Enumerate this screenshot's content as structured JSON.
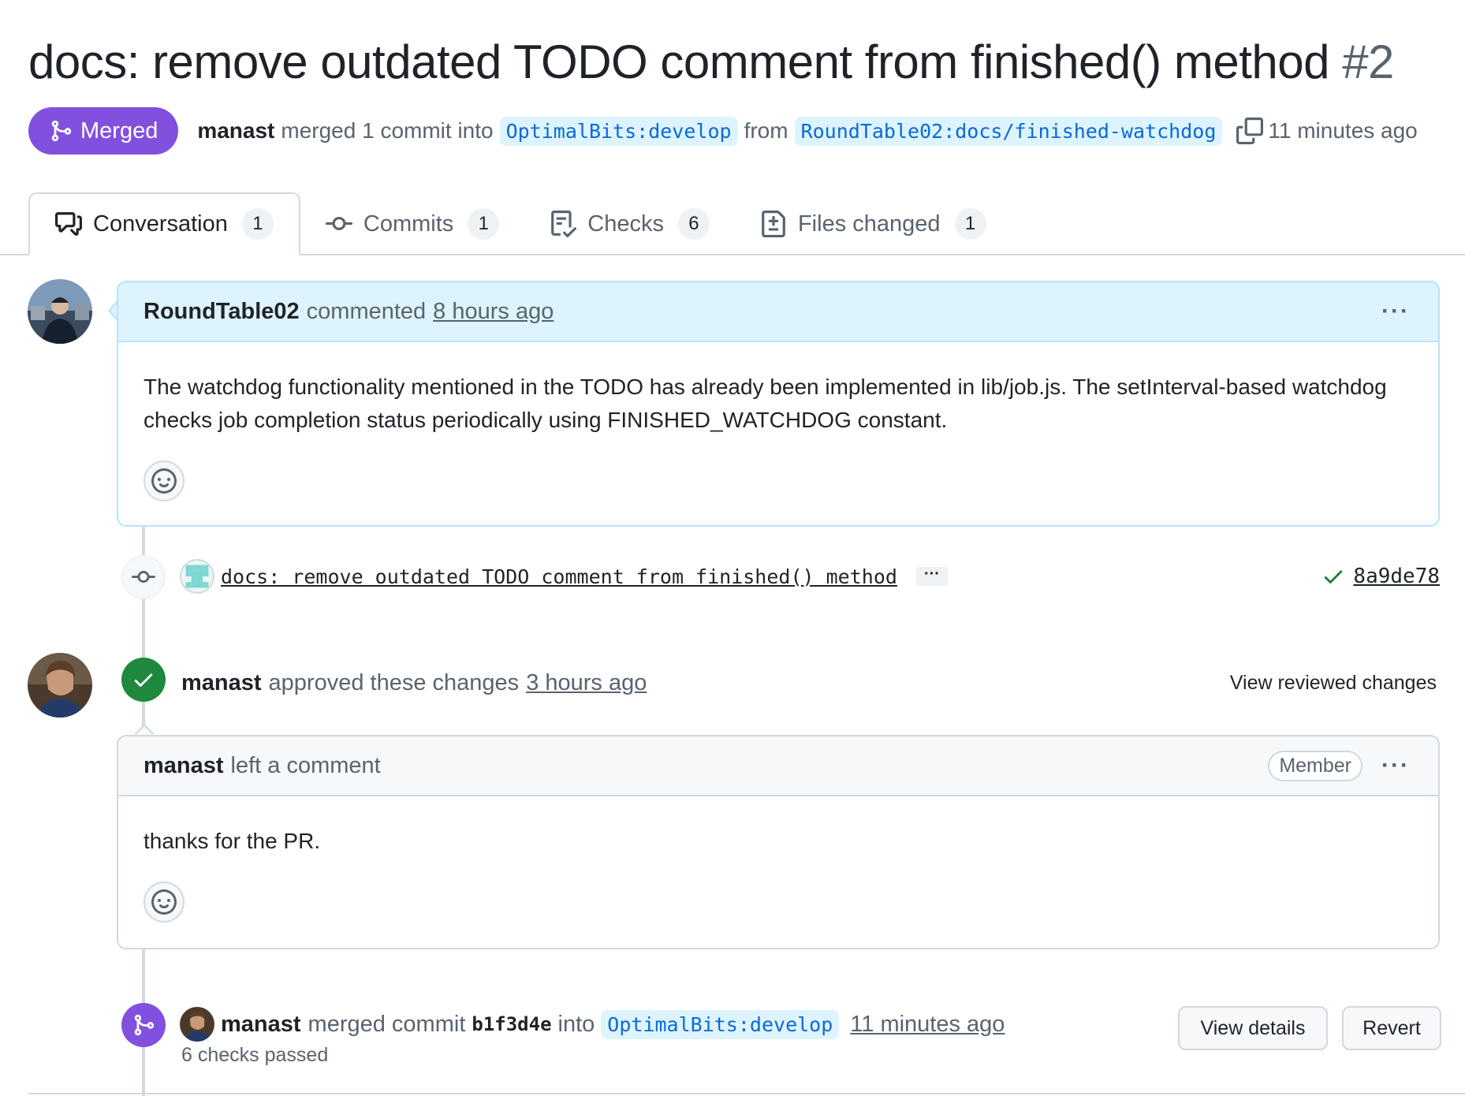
{
  "pr": {
    "title": "docs: remove outdated TODO comment from finished() method",
    "number": "#2",
    "state": "Merged",
    "meta_author": "manast",
    "meta_text": "merged 1 commit into",
    "base_branch": "OptimalBits:develop",
    "from_text": "from",
    "head_branch": "RoundTable02:docs/finished-watchdog",
    "meta_time": "11 minutes ago"
  },
  "tabs": [
    {
      "label": "Conversation",
      "count": "1",
      "icon": "comment-discussion-icon"
    },
    {
      "label": "Commits",
      "count": "1",
      "icon": "git-commit-icon"
    },
    {
      "label": "Checks",
      "count": "6",
      "icon": "checklist-icon"
    },
    {
      "label": "Files changed",
      "count": "1",
      "icon": "file-diff-icon"
    }
  ],
  "comment1": {
    "author": "RoundTable02",
    "action": "commented",
    "time": "8 hours ago",
    "body": "The watchdog functionality mentioned in the TODO has already been implemented in lib/job.js. The setInterval-based watchdog checks job completion status periodically using FINISHED_WATCHDOG constant.",
    "more": "···"
  },
  "commit": {
    "message": "docs: remove outdated TODO comment from finished() method",
    "ellipsis": "···",
    "sha": "8a9de78"
  },
  "review": {
    "author": "manast",
    "action": "approved these changes",
    "time": "3 hours ago",
    "view_link": "View reviewed changes"
  },
  "comment2": {
    "author": "manast",
    "action": "left a comment",
    "badge": "Member",
    "body": "thanks for the PR.",
    "more": "···"
  },
  "merge": {
    "author": "manast",
    "action": "merged commit",
    "sha": "b1f3d4e",
    "into": "into",
    "branch": "OptimalBits:develop",
    "time": "11 minutes ago",
    "checks": "6 checks passed",
    "view_details": "View details",
    "revert": "Revert"
  },
  "colors": {
    "merged_purple": "#8250df",
    "approved_green": "#1f883d",
    "link_blue": "#0969da"
  }
}
